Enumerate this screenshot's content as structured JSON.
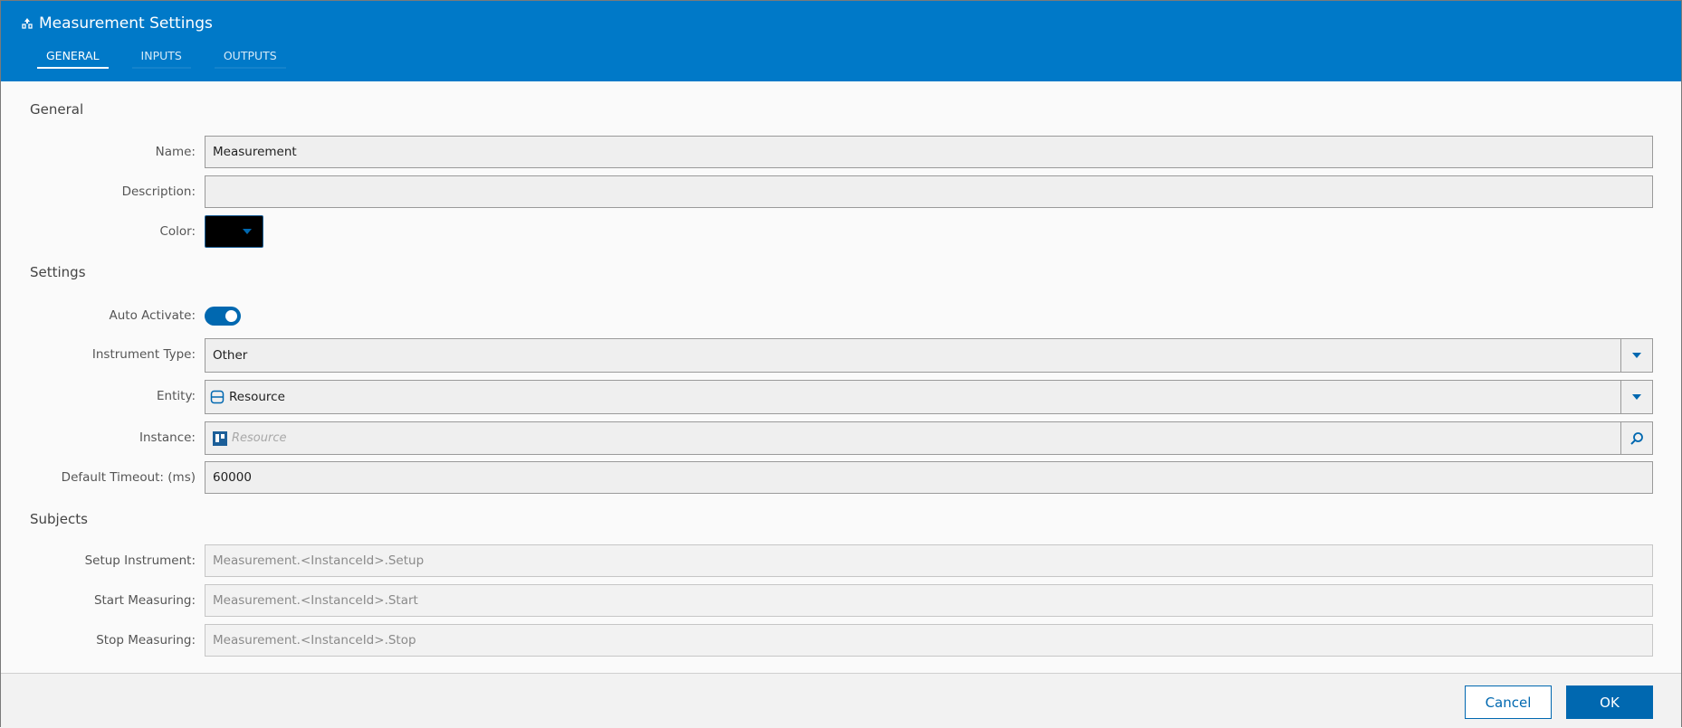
{
  "window": {
    "title": "Measurement Settings"
  },
  "tabs": [
    {
      "label": "GENERAL",
      "active": true
    },
    {
      "label": "INPUTS",
      "active": false
    },
    {
      "label": "OUTPUTS",
      "active": false
    }
  ],
  "sections": {
    "general": "General",
    "settings": "Settings",
    "subjects": "Subjects"
  },
  "general": {
    "name_label": "Name:",
    "name_value": "Measurement",
    "description_label": "Description:",
    "description_value": "",
    "color_label": "Color:",
    "color_value": "#000000"
  },
  "settings": {
    "auto_activate_label": "Auto Activate:",
    "auto_activate_on": true,
    "instrument_type_label": "Instrument Type:",
    "instrument_type_value": "Other",
    "entity_label": "Entity:",
    "entity_value": "Resource",
    "instance_label": "Instance:",
    "instance_placeholder": "Resource",
    "timeout_label": "Default Timeout: (ms)",
    "timeout_value": "60000"
  },
  "subjects": {
    "setup_label": "Setup Instrument:",
    "setup_value": "Measurement.<InstanceId>.Setup",
    "start_label": "Start Measuring:",
    "start_value": "Measurement.<InstanceId>.Start",
    "stop_label": "Stop Measuring:",
    "stop_value": "Measurement.<InstanceId>.Stop"
  },
  "footer": {
    "cancel_label": "Cancel",
    "ok_label": "OK"
  },
  "colors": {
    "header": "#0079c8",
    "accent": "#0068b0"
  }
}
